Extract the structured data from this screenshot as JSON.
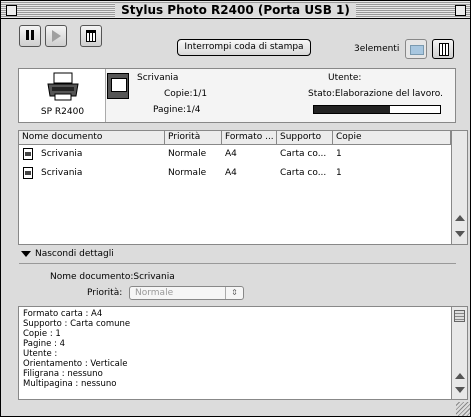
{
  "window": {
    "title": "Stylus Photo R2400 (Porta USB 1)"
  },
  "toolbar": {
    "stop_queue_label": "Interrompi coda di stampa",
    "element_count": "3elementi"
  },
  "printer": {
    "name": "SP R2400"
  },
  "current_job": {
    "document": "Scrivania",
    "copies": "Copie:1/1",
    "pages": "Pagine:1/4",
    "user_label": "Utente:",
    "status": "Stato:Elaborazione del lavoro.",
    "progress_fraction": 0.6
  },
  "table": {
    "headers": [
      "Nome documento",
      "Priorità",
      "Formato ...",
      "Supporto",
      "Copie"
    ],
    "rows": [
      [
        "Scrivania",
        "Normale",
        "A4",
        "Carta co...",
        "1"
      ],
      [
        "Scrivania",
        "Normale",
        "A4",
        "Carta co...",
        "1"
      ]
    ]
  },
  "details": {
    "toggle_label": "Nascondi dettagli",
    "doc_name_label": "Nome documento:Scrivania",
    "priority_label": "Priorità:",
    "priority_value": "Normale",
    "lines": [
      "Formato carta : A4",
      "Supporto : Carta comune",
      "Copie : 1",
      "Pagine : 4",
      "Utente :",
      "Orientamento : Verticale",
      "Filigrana : nessuno",
      "Multipagina : nessuno"
    ]
  },
  "icons": {
    "pause": "pause-icon",
    "play": "play-icon",
    "trash": "trash-icon",
    "printer": "printer-icon",
    "document": "document-icon"
  }
}
